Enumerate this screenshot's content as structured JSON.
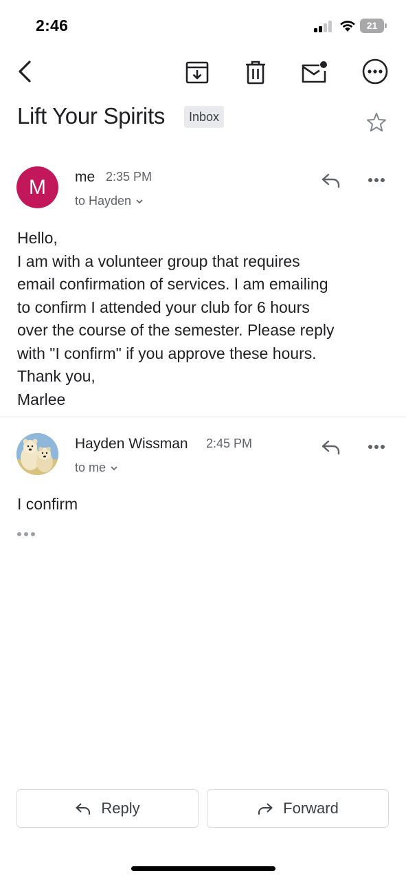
{
  "status_bar": {
    "time": "2:46",
    "battery_level": "21",
    "icons": [
      "signal-icon",
      "wifi-icon",
      "battery-icon"
    ]
  },
  "toolbar": {
    "icons": [
      "back-arrow-icon",
      "archive-icon",
      "trash-icon",
      "mark-unread-icon",
      "more-horizontal-circle-icon"
    ]
  },
  "thread": {
    "subject": "Lift Your Spirits",
    "label": "Inbox",
    "star_icon": "star-outline-icon"
  },
  "messages": [
    {
      "avatar_letter": "M",
      "avatar_color": "#c2185b",
      "sender": "me",
      "time": "2:35 PM",
      "recipient": "to Hayden",
      "body": "Hello,\nI am with a volunteer group that requires\nemail confirmation of services. I am emailing\nto confirm I attended your club for 6 hours\nover the course of the semester. Please reply\nwith \"I confirm\" if you approve these hours.\nThank you,\nMarlee"
    },
    {
      "avatar_icon": "polar-bears-photo-avatar",
      "sender": "Hayden Wissman",
      "time": "2:45 PM",
      "recipient": "to me",
      "body": "I confirm"
    }
  ],
  "actions": {
    "reply_label": "Reply",
    "forward_label": "Forward"
  }
}
